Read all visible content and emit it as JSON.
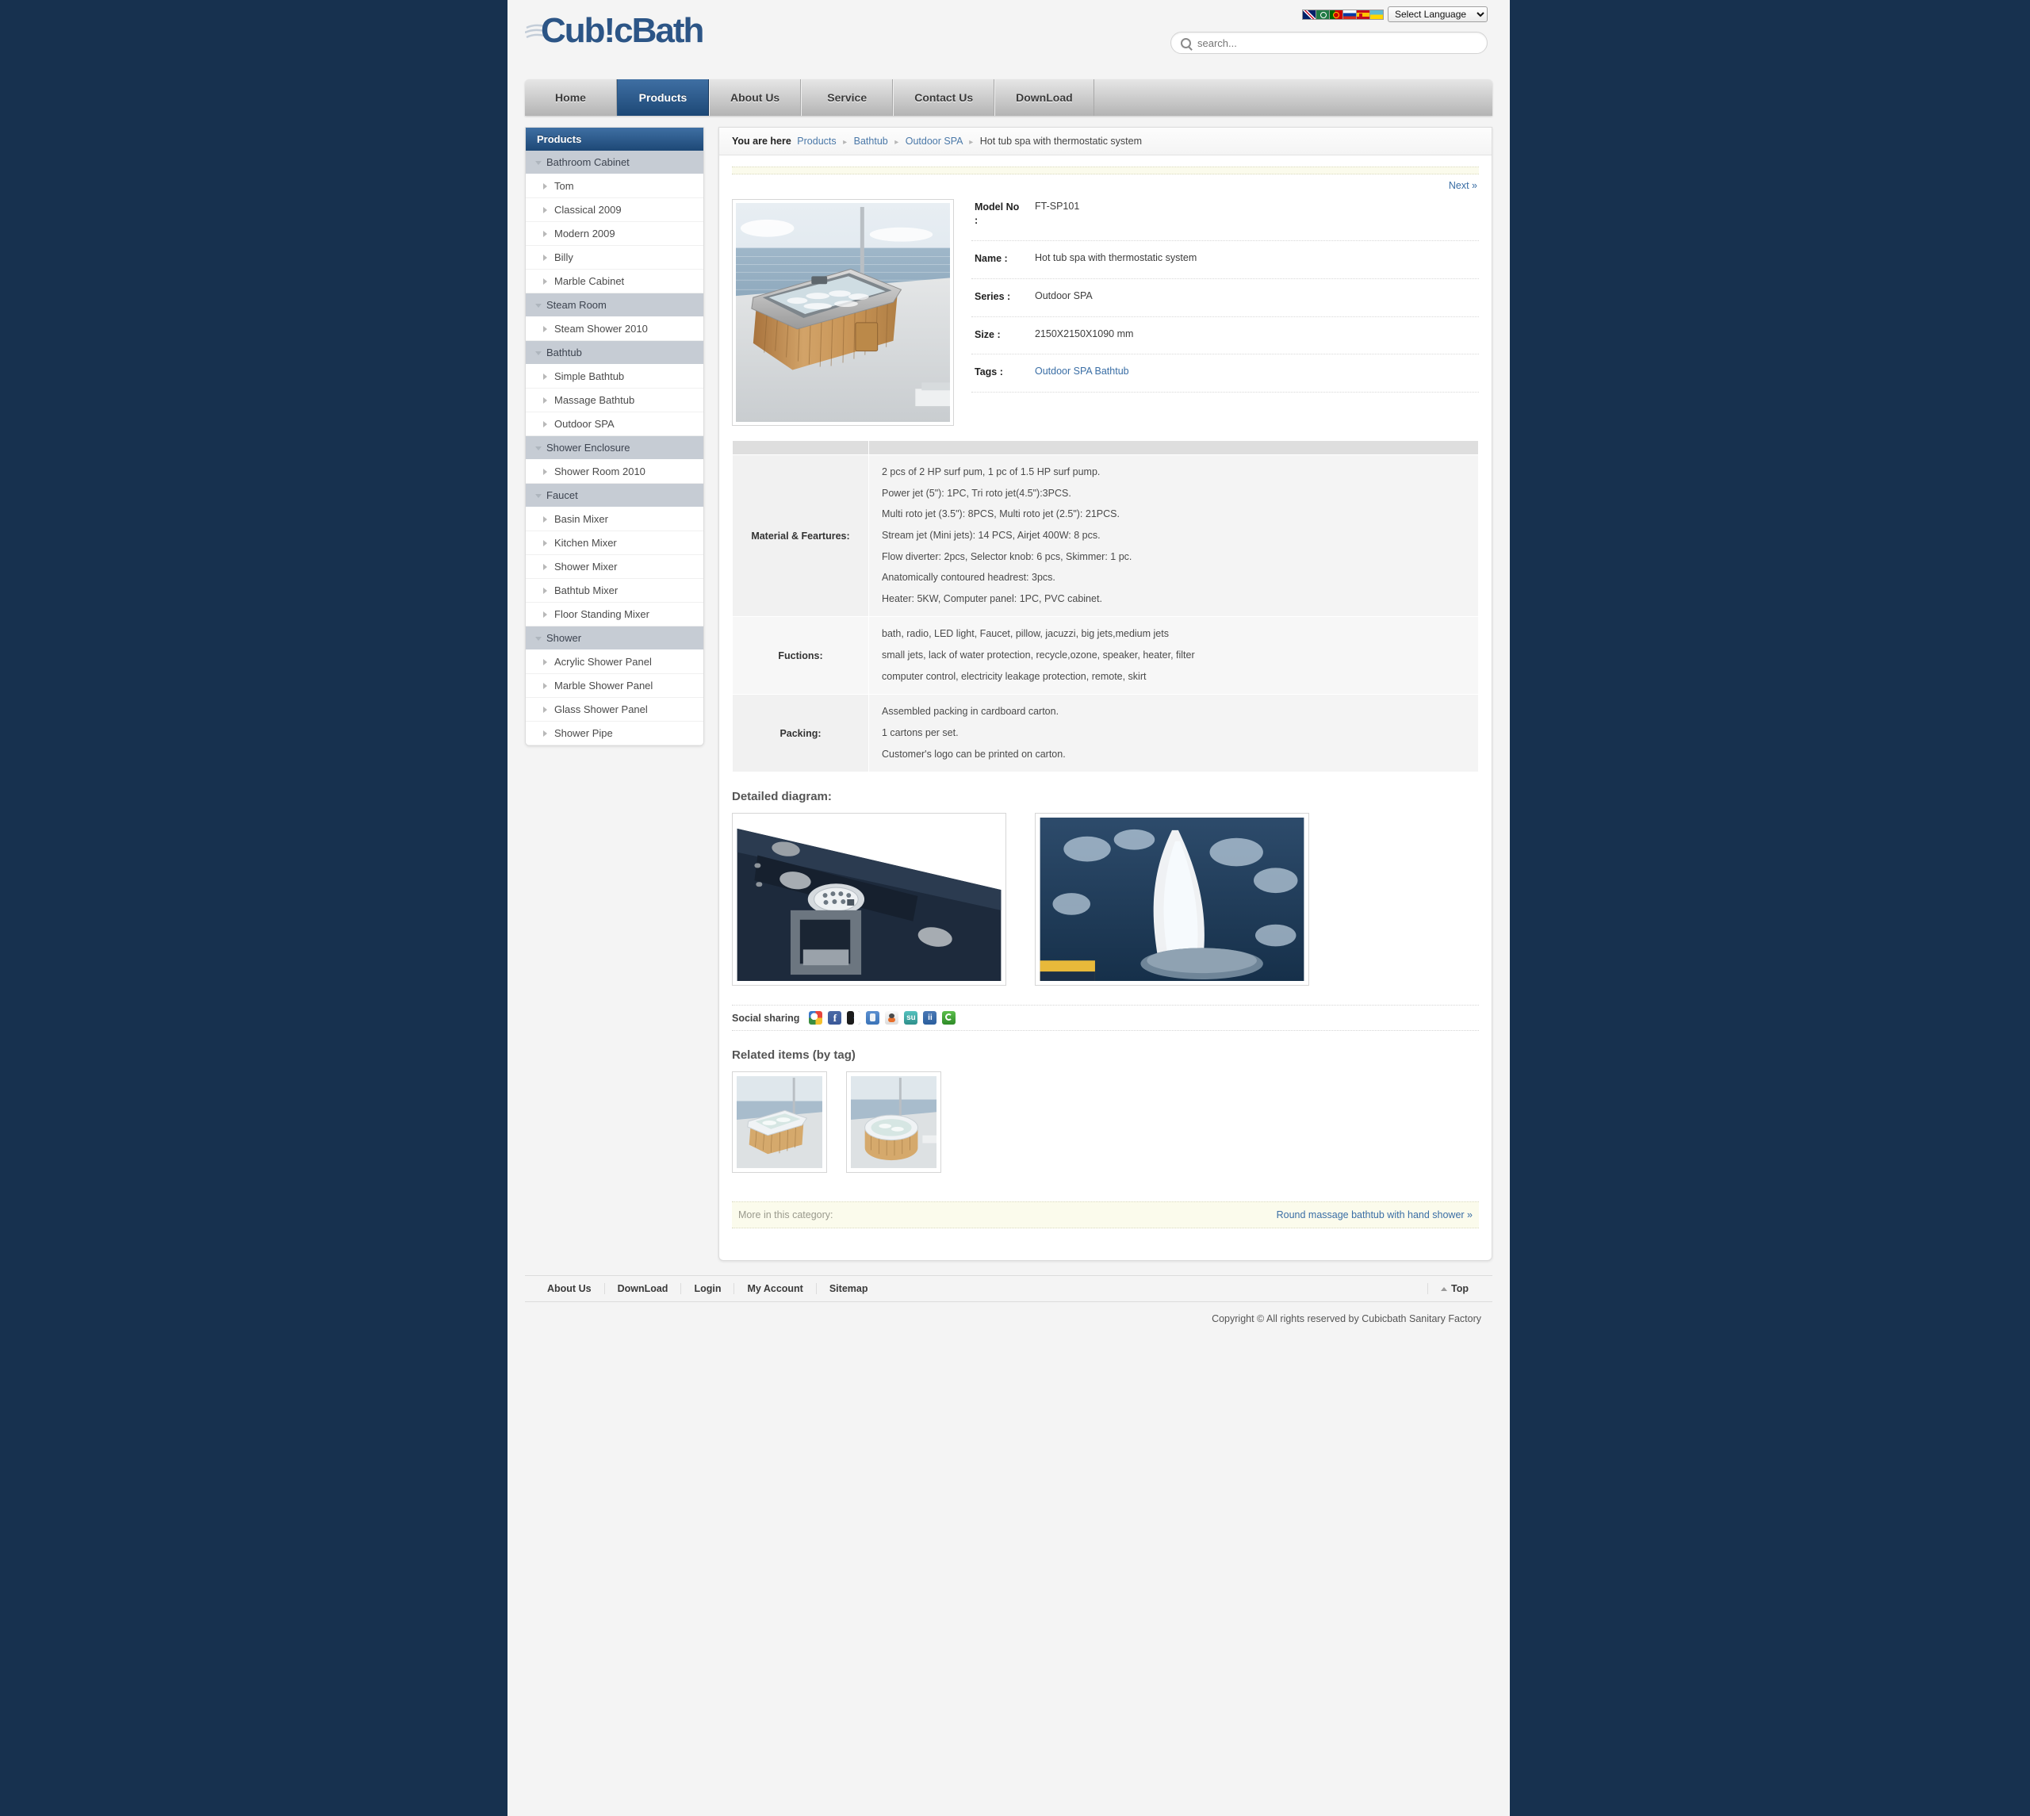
{
  "site": {
    "logo_text": "Cub!cBath",
    "brand_color": "#2c5586"
  },
  "header": {
    "language_select": "Select Language",
    "flags": [
      {
        "name": "flag-uk"
      },
      {
        "name": "flag-arabic"
      },
      {
        "name": "flag-portugal"
      },
      {
        "name": "flag-russia"
      },
      {
        "name": "flag-spain"
      },
      {
        "name": "flag-ukraine"
      }
    ],
    "search_placeholder": "search...",
    "search_value": ""
  },
  "nav": [
    {
      "label": "Home",
      "active": false
    },
    {
      "label": "Products",
      "active": true
    },
    {
      "label": "About Us",
      "active": false
    },
    {
      "label": "Service",
      "active": false
    },
    {
      "label": "Contact Us",
      "active": false
    },
    {
      "label": "DownLoad",
      "active": false
    }
  ],
  "sidebar": {
    "title": "Products",
    "groups": [
      {
        "label": "Bathroom Cabinet",
        "items": [
          "Tom",
          "Classical 2009",
          "Modern 2009",
          "Billy",
          "Marble Cabinet"
        ]
      },
      {
        "label": "Steam Room",
        "items": [
          "Steam Shower 2010"
        ]
      },
      {
        "label": "Bathtub",
        "items": [
          "Simple Bathtub",
          "Massage Bathtub",
          "Outdoor SPA"
        ]
      },
      {
        "label": "Shower Enclosure",
        "items": [
          "Shower Room 2010"
        ]
      },
      {
        "label": "Faucet",
        "items": [
          "Basin Mixer",
          "Kitchen Mixer",
          "Shower Mixer",
          "Bathtub Mixer",
          "Floor Standing Mixer"
        ]
      },
      {
        "label": "Shower",
        "items": [
          "Acrylic Shower Panel",
          "Marble Shower Panel",
          "Glass Shower Panel",
          "Shower Pipe"
        ]
      }
    ]
  },
  "breadcrumb": {
    "prefix": "You are here",
    "items": [
      "Products",
      "Bathtub",
      "Outdoor SPA"
    ],
    "current": "Hot tub spa with thermostatic system"
  },
  "article": {
    "next_label": "Next »",
    "specs": [
      {
        "key": "Model No :",
        "value": "FT-SP101",
        "link": false
      },
      {
        "key": "Name :",
        "value": "Hot tub spa with thermostatic system",
        "link": false
      },
      {
        "key": "Series :",
        "value": "Outdoor SPA",
        "link": false
      },
      {
        "key": "Size :",
        "value": "2150X2150X1090 mm",
        "link": false
      },
      {
        "key": "Tags :",
        "value": "Outdoor SPA Bathtub",
        "link": true
      }
    ],
    "table": [
      {
        "key": "Material & Feartures:",
        "lines": [
          "2 pcs of 2 HP surf pum, 1 pc of 1.5 HP surf pump.",
          "Power jet (5\"): 1PC, Tri roto jet(4.5\"):3PCS.",
          "Multi roto jet (3.5\"): 8PCS, Multi roto jet (2.5\"): 21PCS.",
          "Stream jet (Mini jets): 14 PCS, Airjet 400W: 8 pcs.",
          "Flow diverter: 2pcs, Selector knob: 6 pcs, Skimmer: 1 pc.",
          "Anatomically contoured headrest: 3pcs.",
          "Heater: 5KW, Computer panel: 1PC, PVC cabinet."
        ]
      },
      {
        "key": "Fuctions:",
        "lines": [
          "bath, radio, LED light, Faucet, pillow, jacuzzi, big jets,medium jets",
          "small jets, lack of water protection, recycle,ozone, speaker, heater, filter",
          "computer control, electricity leakage protection, remote, skirt"
        ]
      },
      {
        "key": "Packing:",
        "lines": [
          "Assembled packing in cardboard carton.",
          "1 cartons per set.",
          "Customer's logo can be printed on carton."
        ]
      }
    ],
    "diagram_heading": "Detailed diagram:",
    "social_label": "Social sharing",
    "social_icons": [
      {
        "name": "google-buzz-icon",
        "color": "#ffffff"
      },
      {
        "name": "facebook-icon",
        "color": "#3b5998"
      },
      {
        "name": "delicious-icon",
        "color": "#3274d1"
      },
      {
        "name": "digg-thumb-icon",
        "color": "#3b74b8"
      },
      {
        "name": "reddit-icon",
        "color": "#f0f0f0"
      },
      {
        "name": "stumbleupon-icon",
        "color": "#3aa9a5"
      },
      {
        "name": "mixx-icon",
        "color": "#2b5f9e"
      },
      {
        "name": "technorati-icon",
        "color": "#3f9e35"
      }
    ],
    "related_heading": "Related items (by tag)"
  },
  "more_category": {
    "label": "More in this category:",
    "link": "Round massage bathtub with hand shower »"
  },
  "footer": {
    "links": [
      "About Us",
      "DownLoad",
      "Login",
      "My Account",
      "Sitemap"
    ],
    "top_label": "Top",
    "copyright": "Copyright © All rights reserved by Cubicbath Sanitary Factory"
  }
}
